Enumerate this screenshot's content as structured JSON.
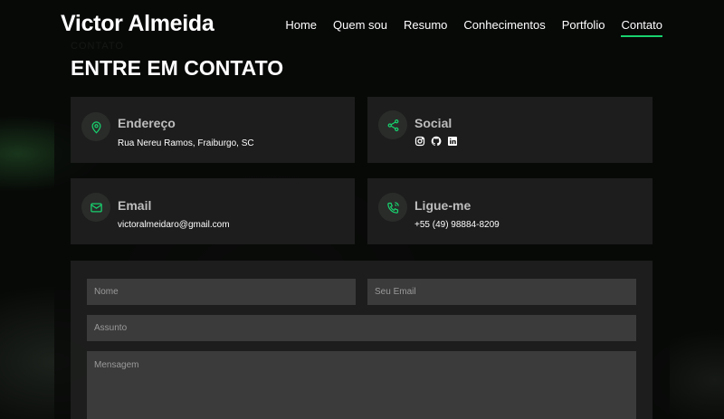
{
  "header": {
    "logo": "Victor Almeida",
    "nav": [
      {
        "label": "Home"
      },
      {
        "label": "Quem sou"
      },
      {
        "label": "Resumo"
      },
      {
        "label": "Conhecimentos"
      },
      {
        "label": "Portfolio"
      },
      {
        "label": "Contato",
        "active": true
      }
    ]
  },
  "section": {
    "bg_label": "CONTATO",
    "title": "ENTRE EM CONTATO"
  },
  "cards": {
    "address": {
      "title": "Endereço",
      "text": "Rua Nereu Ramos, Fraiburgo, SC",
      "icon": "map-pin-icon"
    },
    "social": {
      "title": "Social",
      "icons": [
        "instagram-icon",
        "github-icon",
        "linkedin-icon"
      ],
      "icon": "share-icon"
    },
    "email": {
      "title": "Email",
      "text": "victoralmeidaro@gmail.com",
      "icon": "envelope-icon"
    },
    "phone": {
      "title": "Ligue-me",
      "text": "+55 (49) 98884-8209",
      "icon": "phone-icon"
    }
  },
  "form": {
    "name_placeholder": "Nome",
    "email_placeholder": "Seu Email",
    "subject_placeholder": "Assunto",
    "message_placeholder": "Mensagem"
  },
  "colors": {
    "accent": "#18d26e",
    "card_bg": "#1e1f1e",
    "field_bg": "#3a3b3a"
  }
}
